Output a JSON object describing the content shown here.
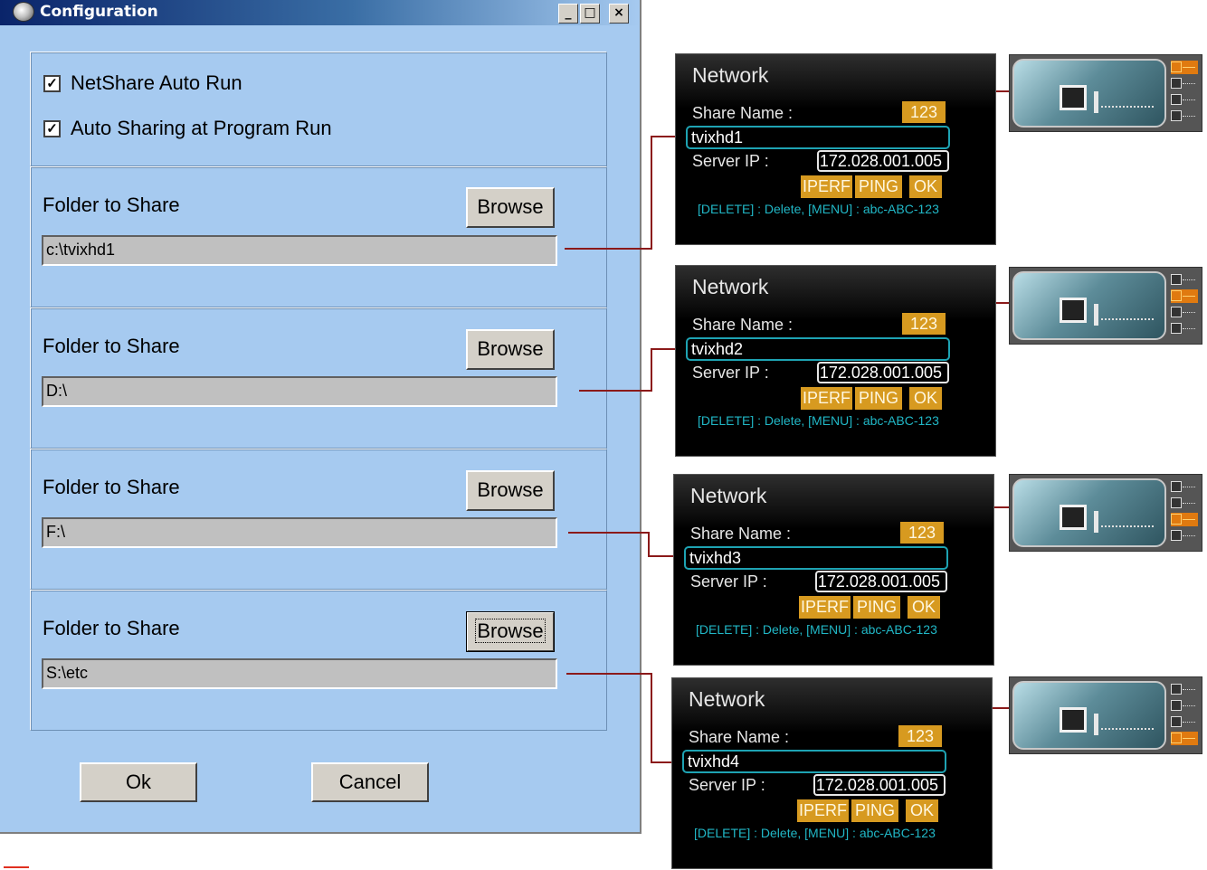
{
  "dialog": {
    "title": "Configuration",
    "caption_buttons": [
      "_",
      "□",
      "×"
    ],
    "options": [
      {
        "label": "NetShare  Auto Run",
        "checked": true
      },
      {
        "label": "Auto Sharing at Program Run",
        "checked": true
      }
    ],
    "check_glyph": "✓",
    "folders": [
      {
        "label": "Folder to Share",
        "button": "Browse",
        "path": "c:\\tvixhd1"
      },
      {
        "label": "Folder to Share",
        "button": "Browse",
        "path": "D:\\"
      },
      {
        "label": "Folder to Share",
        "button": "Browse",
        "path": "F:\\"
      },
      {
        "label": "Folder to Share",
        "button": "Browse",
        "path": "S:\\etc"
      }
    ],
    "ok_label": "Ok",
    "cancel_label": "Cancel"
  },
  "network_panels": [
    {
      "title": "Network",
      "share_name_label": "Share Name :",
      "badge": "123",
      "share_name": "tvixhd1",
      "server_ip_label": "Server IP :",
      "server_ip": "172.028.001.005",
      "buttons": [
        "IPERF",
        "PING",
        "OK"
      ],
      "hint": "[DELETE] : Delete, [MENU] : abc-ABC-123",
      "active_slot": 1
    },
    {
      "title": "Network",
      "share_name_label": "Share Name :",
      "badge": "123",
      "share_name": "tvixhd2",
      "server_ip_label": "Server IP :",
      "server_ip": "172.028.001.005",
      "buttons": [
        "IPERF",
        "PING",
        "OK"
      ],
      "hint": "[DELETE] : Delete, [MENU] : abc-ABC-123",
      "active_slot": 2
    },
    {
      "title": "Network",
      "share_name_label": "Share Name :",
      "badge": "123",
      "share_name": "tvixhd3",
      "server_ip_label": "Server IP :",
      "server_ip": "172.028.001.005",
      "buttons": [
        "IPERF",
        "PING",
        "OK"
      ],
      "hint": "[DELETE] : Delete, [MENU] : abc-ABC-123",
      "active_slot": 3
    },
    {
      "title": "Network",
      "share_name_label": "Share Name :",
      "badge": "123",
      "share_name": "tvixhd4",
      "server_ip_label": "Server IP :",
      "server_ip": "172.028.001.005",
      "buttons": [
        "IPERF",
        "PING",
        "OK"
      ],
      "hint": "[DELETE] : Delete, [MENU] : abc-ABC-123",
      "active_slot": 4
    }
  ],
  "icons": {
    "title_icon": "app-globe-icon",
    "thumbnail_icon": "monitor-icon"
  },
  "colors": {
    "dialog_bg": "#a6caf0",
    "connector": "#8b1a1a",
    "accent_orange": "#d79a20",
    "field_cyan": "#1ea3b3"
  }
}
